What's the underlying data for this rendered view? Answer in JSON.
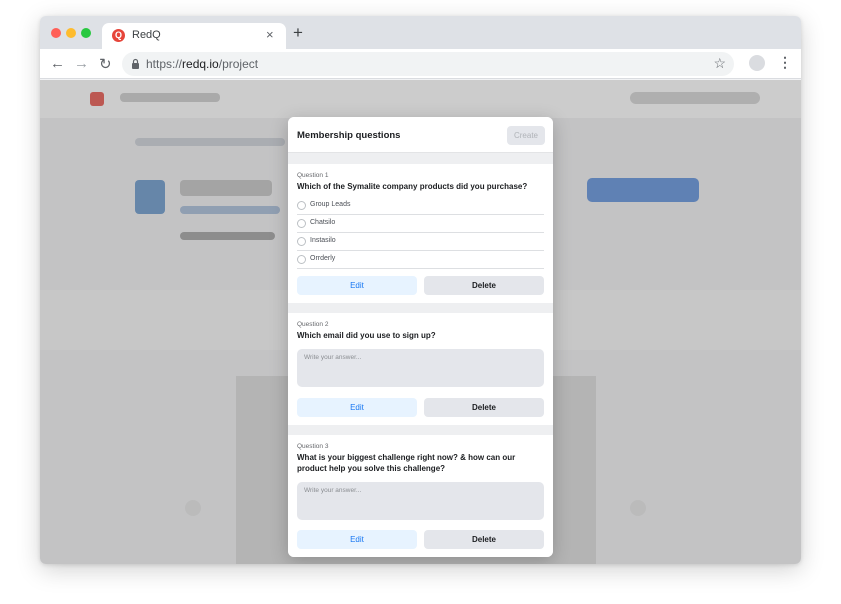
{
  "browser": {
    "tab_title": "RedQ",
    "tab_logo": "Q",
    "tab_close": "×",
    "new_tab": "+",
    "url_scheme": "https://",
    "url_host": "redq.io",
    "url_path": "/project",
    "icons": [
      "back-icon",
      "forward-icon",
      "reload-icon",
      "lock-icon",
      "star-icon",
      "profile-icon",
      "menu-icon"
    ]
  },
  "modal": {
    "title": "Membership questions",
    "create_label": "Create",
    "questions": [
      {
        "label": "Question 1",
        "text": "Which of the Symalite company products did you purchase?",
        "options": [
          "Group Leads",
          "Chatsilo",
          "Instasilo",
          "Orrderly"
        ],
        "edit": "Edit",
        "delete": "Delete"
      },
      {
        "label": "Question 2",
        "text": "Which email did you use to sign up?",
        "placeholder": "Write your answer...",
        "edit": "Edit",
        "delete": "Delete"
      },
      {
        "label": "Question 3",
        "text": "What is your biggest challenge right now? & how can our product help you solve this challenge?",
        "placeholder": "Write your answer...",
        "edit": "Edit",
        "delete": "Delete"
      }
    ]
  },
  "colors": {
    "accent": "#1877f2",
    "edit_bg": "#e7f3ff",
    "button_bg": "#e4e6eb",
    "brand": "#e6453a"
  }
}
